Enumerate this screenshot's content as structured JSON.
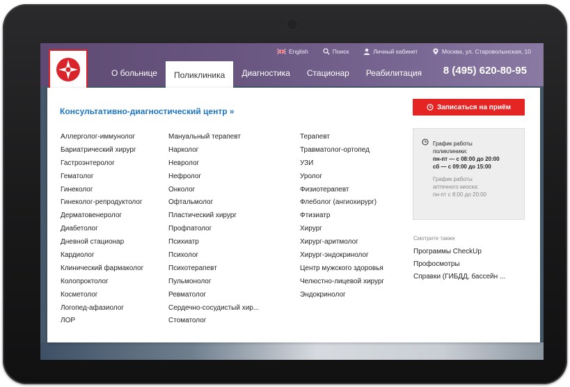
{
  "topbar": {
    "language": "English",
    "search": "Поиск",
    "cabinet": "Личный кабинет",
    "address": "Москва, ул. Староволынская, 10"
  },
  "nav": {
    "items": [
      {
        "label": "О больнице"
      },
      {
        "label": "Поликлиника"
      },
      {
        "label": "Диагностика"
      },
      {
        "label": "Стационар"
      },
      {
        "label": "Реабилитация"
      }
    ],
    "active": "Поликлиника"
  },
  "phone": "8 (495) 620-80-95",
  "panel": {
    "title": "Консультативно-диагностический центр »",
    "columns": [
      [
        "Аллерголог-иммунолог",
        "Бариатрический хирург",
        "Гастроэнтеролог",
        "Гематолог",
        "Гинеколог",
        "Гинеколог-репродуктолог",
        "Дерматовенеролог",
        "Диабетолог",
        "Дневной стационар",
        "Кардиолог",
        "Клинический фармаколог",
        "Колопроктолог",
        "Косметолог",
        "Логопед-афазиолог",
        "ЛОР"
      ],
      [
        "Мануальный терапевт",
        "Нарколог",
        "Невролог",
        "Нефролог",
        "Онколог",
        "Офтальмолог",
        "Пластический хирург",
        "Профпатолог",
        "Психиатр",
        "Психолог",
        "Психотерапевт",
        "Пульмонолог",
        "Ревматолог",
        "Сердечно-сосудистый хир...",
        "Стоматолог"
      ],
      [
        "Терапевт",
        "Травматолог-ортопед",
        "УЗИ",
        "Уролог",
        "Физиотерапевт",
        "Флеболог (ангиохирург)",
        "Фтизиатр",
        "Хирург",
        "Хирург-аритмолог",
        "Хирург-эндокринолог",
        "Центр мужского здоровья",
        "Челюстно-лицевой хирург",
        "Эндокринолог"
      ]
    ],
    "book_button": "Записаться на приём",
    "hours": {
      "title1": "График работы",
      "title2": "поликлиники:",
      "weekdays": "пн-пт — с 08:00 до 20:00",
      "saturday": "сб — с 09:00 до 15:00",
      "pharmacy1": "График работы",
      "pharmacy2": "аптечного киоска:",
      "pharmacy3": "пн-пт с 8:00 до 20:00"
    },
    "see_also": {
      "label": "Смотрите также",
      "links": [
        "Программы CheckUp",
        "Профосмотры",
        "Справки (ГИБДД, бассейн ..."
      ]
    }
  },
  "colors": {
    "accent_blue": "#1e75c2",
    "button_red": "#e52424",
    "header_purple": "#6b5883"
  }
}
